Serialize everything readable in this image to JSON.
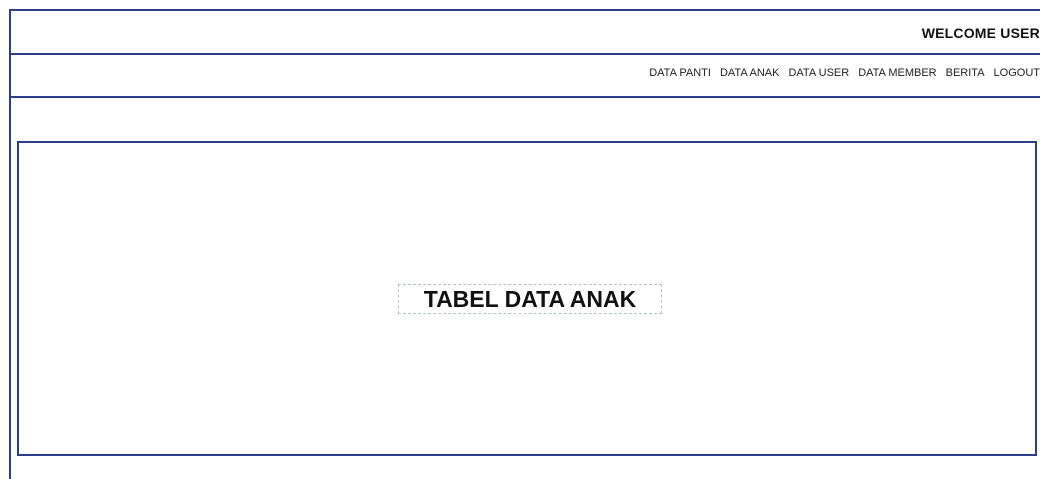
{
  "header": {
    "welcome_text": "WELCOME USER"
  },
  "nav": {
    "items": [
      {
        "label": "DATA PANTI"
      },
      {
        "label": "DATA ANAK"
      },
      {
        "label": "DATA USER"
      },
      {
        "label": "DATA MEMBER"
      },
      {
        "label": "BERITA"
      },
      {
        "label": "LOGOUT"
      }
    ]
  },
  "main": {
    "title": "TABEL DATA ANAK"
  },
  "colors": {
    "border": "#2c3e8c",
    "text": "#111111",
    "background": "#ffffff"
  }
}
